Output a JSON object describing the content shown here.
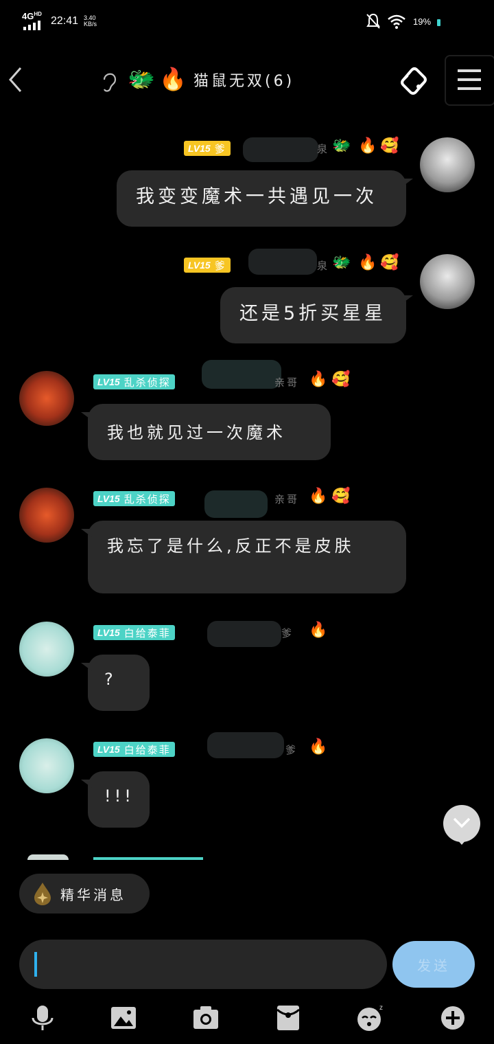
{
  "status_bar": {
    "network": "4G",
    "network_sub": "HD",
    "time": "22:41",
    "speed_value": "3.40",
    "speed_unit": "KB/s",
    "battery": "19%"
  },
  "header": {
    "title": "猫鼠无双(6)",
    "icons": [
      "back-icon",
      "ear-icon",
      "dragon-emoji",
      "fire-emoji",
      "link-icon",
      "menu-icon"
    ]
  },
  "messages": [
    {
      "side": "right",
      "level": "LV15",
      "title": "爹",
      "name_fragment": "泉",
      "text": "我变变魔术一共遇见一次"
    },
    {
      "side": "right",
      "level": "LV15",
      "title": "爹",
      "name_fragment": "泉",
      "text": "还是5折买星星"
    },
    {
      "side": "left",
      "level": "LV15",
      "title": "乱杀侦探",
      "name_fragment": "亲哥",
      "text": "我也就见过一次魔术"
    },
    {
      "side": "left",
      "level": "LV15",
      "title": "乱杀侦探",
      "name_fragment": "亲哥",
      "text": "我忘了是什么,反正不是皮肤"
    },
    {
      "side": "left",
      "level": "LV15",
      "title": "白给泰菲",
      "name_fragment": "爹",
      "text": "?"
    },
    {
      "side": "left",
      "level": "LV15",
      "title": "白给泰菲",
      "name_fragment": "爹",
      "text": "!!!"
    }
  ],
  "digest_button": {
    "label": "精华消息"
  },
  "composer": {
    "value": "",
    "send_label": "发送"
  },
  "toolbar_icons": [
    "microphone-icon",
    "image-icon",
    "camera-icon",
    "red-packet-icon",
    "sticker-icon",
    "plus-icon"
  ],
  "colors": {
    "level_gold": "#f7c523",
    "level_teal": "#4dd3c6",
    "bubble": "#2a2a2a",
    "send": "#8fc5ef",
    "cursor": "#2fb1ee"
  }
}
